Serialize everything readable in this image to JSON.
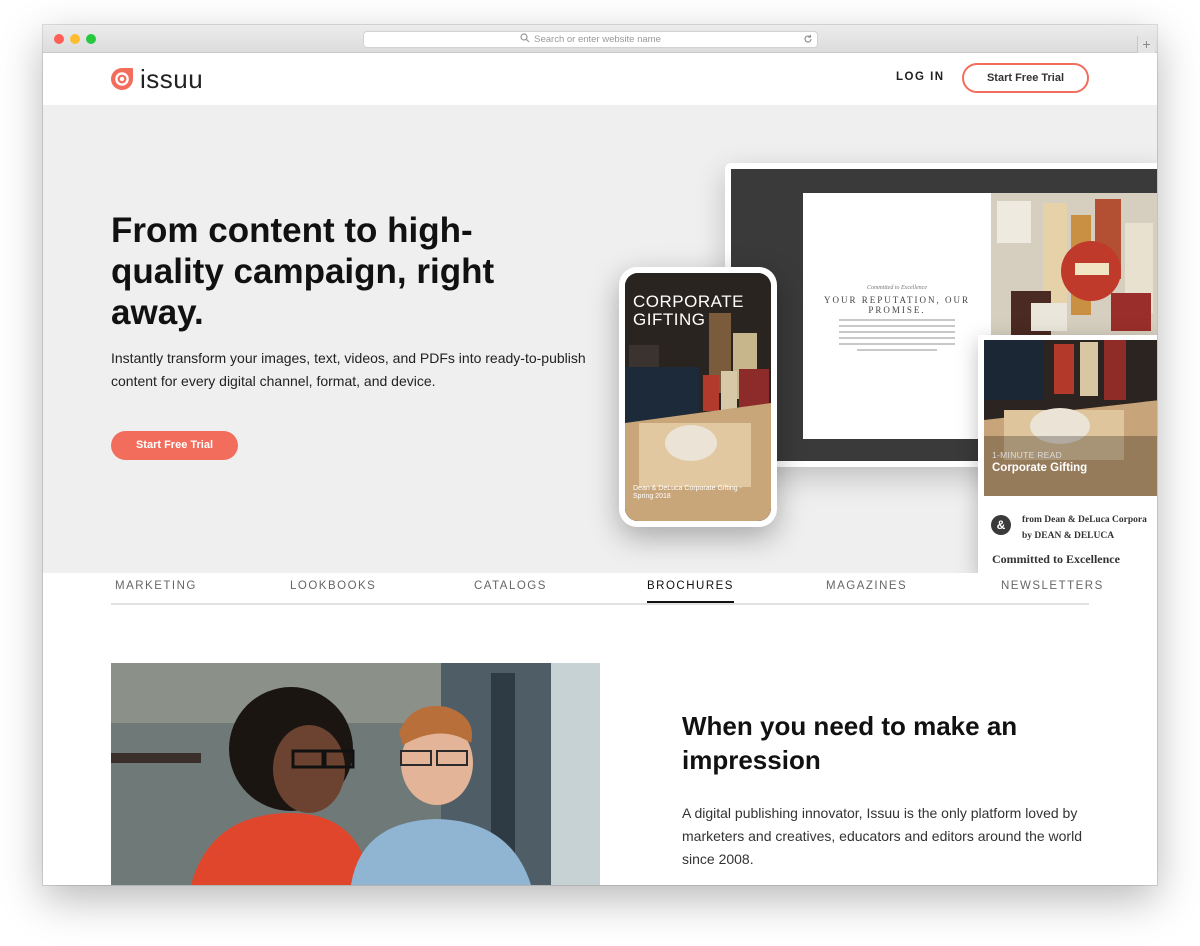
{
  "browser": {
    "address_placeholder": "Search or enter website name"
  },
  "nav": {
    "logo_text": "issuu",
    "login": "LOG IN",
    "trial": "Start Free Trial"
  },
  "hero": {
    "headline": "From content to high-quality campaign, right away.",
    "subtext": "Instantly transform your images, text, videos, and PDFs into ready-to-publish content for every digital channel, format, and device.",
    "cta": "Start Free Trial"
  },
  "preview": {
    "spread_kicker": "Committed to Excellence",
    "spread_heading": "YOUR REPUTATION, OUR PROMISE.",
    "phone_title": "CORPORATE GIFTING",
    "phone_caption": "Dean & DeLuca Corporate Gifting - Spring 2018",
    "card_read_time": "1-MINUTE READ",
    "card_title": "Corporate Gifting",
    "card_from": "from Dean & DeLuca Corpora",
    "card_by": "by DEAN & DELUCA",
    "card_committed": "Committed to Excellence"
  },
  "tabs": [
    {
      "label": "MARKETING",
      "active": false
    },
    {
      "label": "LOOKBOOKS",
      "active": false
    },
    {
      "label": "CATALOGS",
      "active": false
    },
    {
      "label": "BROCHURES",
      "active": true
    },
    {
      "label": "MAGAZINES",
      "active": false
    },
    {
      "label": "NEWSLETTERS",
      "active": false
    }
  ],
  "section": {
    "heading": "When you need to make an impression",
    "body": "A digital publishing innovator, Issuu is the only platform loved by marketers and creatives, educators and editors around the world since 2008."
  },
  "colors": {
    "accent": "#f36d5c",
    "hero_bg": "#efefef",
    "text": "#111111"
  }
}
